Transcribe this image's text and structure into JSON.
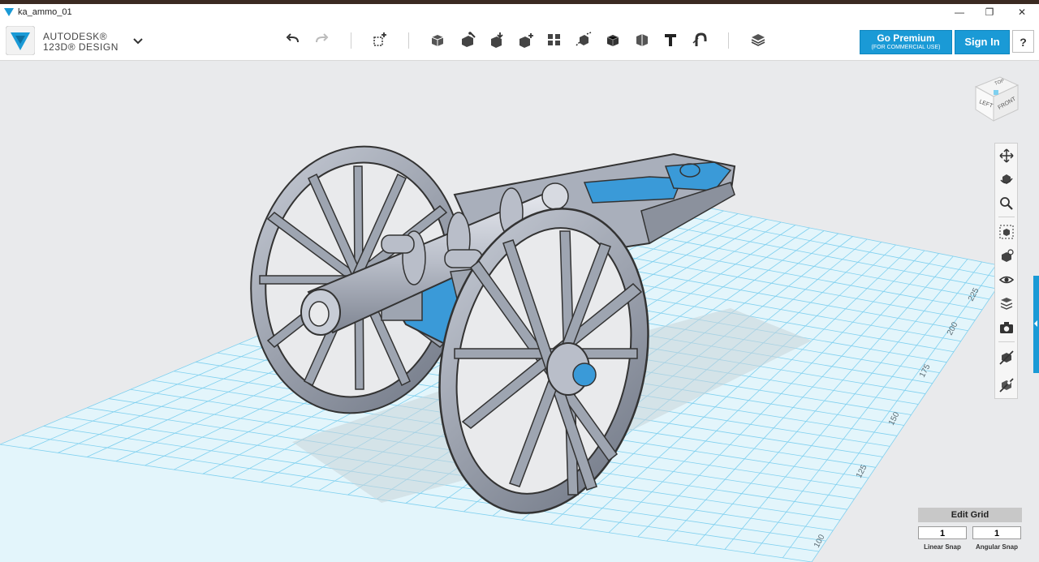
{
  "window": {
    "title": "ka_ammo_01",
    "minimize": "—",
    "restore": "❐",
    "close": "✕"
  },
  "brand": {
    "line1": "AUTODESK®",
    "line2": "123D® DESIGN"
  },
  "toolbar": {
    "tools": [
      "undo-icon",
      "redo-icon",
      "primitives-icon",
      "sketch-icon",
      "construct-icon",
      "modify-icon",
      "pattern-icon",
      "grouping-icon",
      "combine-icon",
      "measure-icon",
      "text-icon",
      "snap-icon",
      "materials-icon"
    ]
  },
  "account": {
    "premium_label": "Go Premium",
    "premium_sub": "(FOR COMMERCIAL USE)",
    "signin_label": "Sign In",
    "help_label": "?"
  },
  "viewcube": {
    "top": "TOP",
    "left": "LEFT",
    "front": "FRONT"
  },
  "grid_labels": [
    "225",
    "200",
    "175",
    "150",
    "125",
    "100"
  ],
  "grid": {
    "edit_label": "Edit Grid",
    "linear_snap_value": "1",
    "angular_snap_value": "1",
    "linear_snap_label": "Linear Snap",
    "angular_snap_label": "Angular Snap"
  },
  "colors": {
    "accent": "#1a9ad6",
    "grid_line": "#5bc0e8",
    "model_gray": "#b6bcc8",
    "model_blue": "#3a9ad8"
  }
}
